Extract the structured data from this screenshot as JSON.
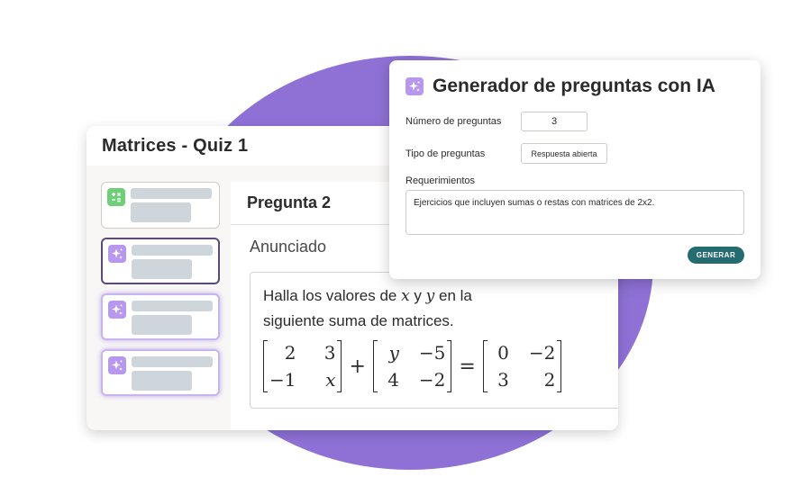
{
  "quiz": {
    "title": "Matrices - Quiz 1",
    "question_label": "Pregunta 2",
    "statement_label": "Anunciado",
    "question_text_before": "Halla los valores de",
    "var_x": "x",
    "word_and": "y",
    "var_y": "y",
    "question_text_after": "en la siguiente suma de matrices.",
    "equation": {
      "matrix_a": [
        "2",
        "3",
        "−1",
        "x"
      ],
      "op_plus": "+",
      "matrix_b": [
        "y",
        "−5",
        "4",
        "−2"
      ],
      "op_equals": "=",
      "matrix_c": [
        "0",
        "−2",
        "3",
        "2"
      ]
    },
    "thumbnails": [
      {
        "icon": "calculator-icon",
        "state": "normal"
      },
      {
        "icon": "sparkle-icon",
        "state": "selected"
      },
      {
        "icon": "sparkle-icon",
        "state": "ai-generated"
      },
      {
        "icon": "sparkle-icon",
        "state": "ai-generated"
      }
    ]
  },
  "ai_generator": {
    "title": "Generador de preguntas con IA",
    "icon": "sparkle-icon",
    "num_label": "Número de preguntas",
    "num_value": "3",
    "type_label": "Tipo de preguntas",
    "type_value": "Respuesta abierta",
    "req_label": "Requerimientos",
    "req_value": "Ejercicios que incluyen sumas o restas con matrices de 2x2.",
    "button_label": "GENERAR"
  },
  "colors": {
    "blob": "#8f71d6",
    "button": "#256c72",
    "ai_icon": "#b898ee",
    "calc_icon": "#6fcf79"
  }
}
